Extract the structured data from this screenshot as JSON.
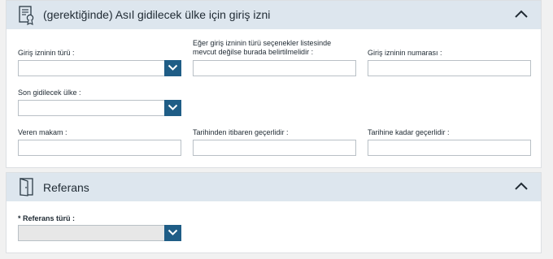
{
  "entry_permit": {
    "title": "(gerektiğinde) Asıl gidilecek ülke için giriş izni",
    "permit_type_label": "Giriş izninin türü :",
    "permit_type_value": "",
    "other_type_label_line1": "Eğer giriş izninin türü seçenekler listesinde",
    "other_type_label_line2": "mevcut değilse burada belirtilmelidir :",
    "other_type_value": "",
    "permit_number_label": "Giriş izninin numarası :",
    "permit_number_value": "",
    "last_country_label": "Son gidilecek ülke :",
    "last_country_value": "",
    "issuing_authority_label": "Veren makam :",
    "issuing_authority_value": "",
    "valid_from_label": "Tarihinden itibaren geçerlidir :",
    "valid_from_value": "",
    "valid_until_label": "Tarihine kadar geçerlidir :",
    "valid_until_value": "",
    "icon": "certificate-icon"
  },
  "reference": {
    "title": "Referans",
    "type_label": "* Referans türü :",
    "type_value": "",
    "icon": "door-icon"
  },
  "colors": {
    "header_bg": "#dde6ee",
    "select_button": "#1f5d86",
    "input_border": "#b9c0c6"
  }
}
